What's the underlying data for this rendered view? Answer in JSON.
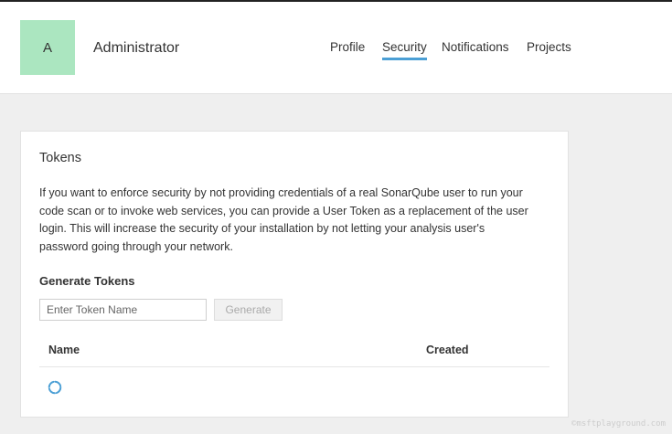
{
  "user": {
    "avatar_letter": "A",
    "name": "Administrator"
  },
  "nav": {
    "items": [
      {
        "label": "Profile",
        "active": false
      },
      {
        "label": "Security",
        "active": true
      },
      {
        "label": "Notifications",
        "active": false
      },
      {
        "label": "Projects",
        "active": false
      }
    ]
  },
  "tokens": {
    "title": "Tokens",
    "description": "If you want to enforce security by not providing credentials of a real SonarQube user to run your code scan or to invoke web services, you can provide a User Token as a replacement of the user login. This will increase the security of your installation by not letting your analysis user's password going through your network.",
    "generate_title": "Generate Tokens",
    "input_placeholder": "Enter Token Name",
    "input_value": "",
    "generate_label": "Generate",
    "table_headers": {
      "name": "Name",
      "created": "Created"
    }
  },
  "watermark": "©msftplayground.com",
  "colors": {
    "avatar": "#abe6c0",
    "active_tab": "#4b9fd5",
    "spinner": "#4b9fd5"
  }
}
